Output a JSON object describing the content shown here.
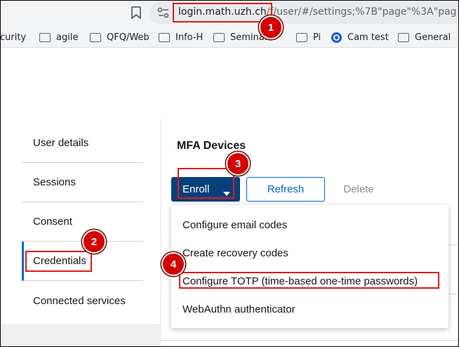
{
  "browser": {
    "url_host": "login.math.uzh.ch",
    "url_path": "/f/user/#/settings;%7B\"page\"%3A\"pag",
    "bookmarks": [
      {
        "label": "ecurity",
        "icon": "none"
      },
      {
        "label": "agile",
        "icon": "folder-icon"
      },
      {
        "label": "QFQ/Web",
        "icon": "folder-icon"
      },
      {
        "label": "Info-H",
        "icon": "folder-icon"
      },
      {
        "label": "Seminar",
        "icon": "folder-icon"
      },
      {
        "label": "Pi",
        "icon": "folder-icon"
      },
      {
        "label": "Cam test",
        "icon": "cam-icon"
      },
      {
        "label": "General",
        "icon": "folder-icon"
      }
    ]
  },
  "sidebar": {
    "items": [
      {
        "label": "User details"
      },
      {
        "label": "Sessions"
      },
      {
        "label": "Consent"
      },
      {
        "label": "Credentials"
      },
      {
        "label": "Connected services"
      }
    ]
  },
  "main": {
    "title": "MFA Devices",
    "enroll_label": "Enroll",
    "refresh_label": "Refresh",
    "delete_label": "Delete",
    "menu_items": [
      {
        "label": "Configure email codes"
      },
      {
        "label": "Create recovery codes"
      },
      {
        "label": "Configure TOTP (time-based one-time passwords)"
      },
      {
        "label": "WebAuthn authenticator"
      }
    ]
  },
  "annotations": {
    "badges": [
      "1",
      "2",
      "3",
      "4"
    ],
    "color": "#e01b1b"
  },
  "colors": {
    "primary_button": "#06407a",
    "link_blue": "#0066cc",
    "active_nav_border": "#0066cc"
  }
}
